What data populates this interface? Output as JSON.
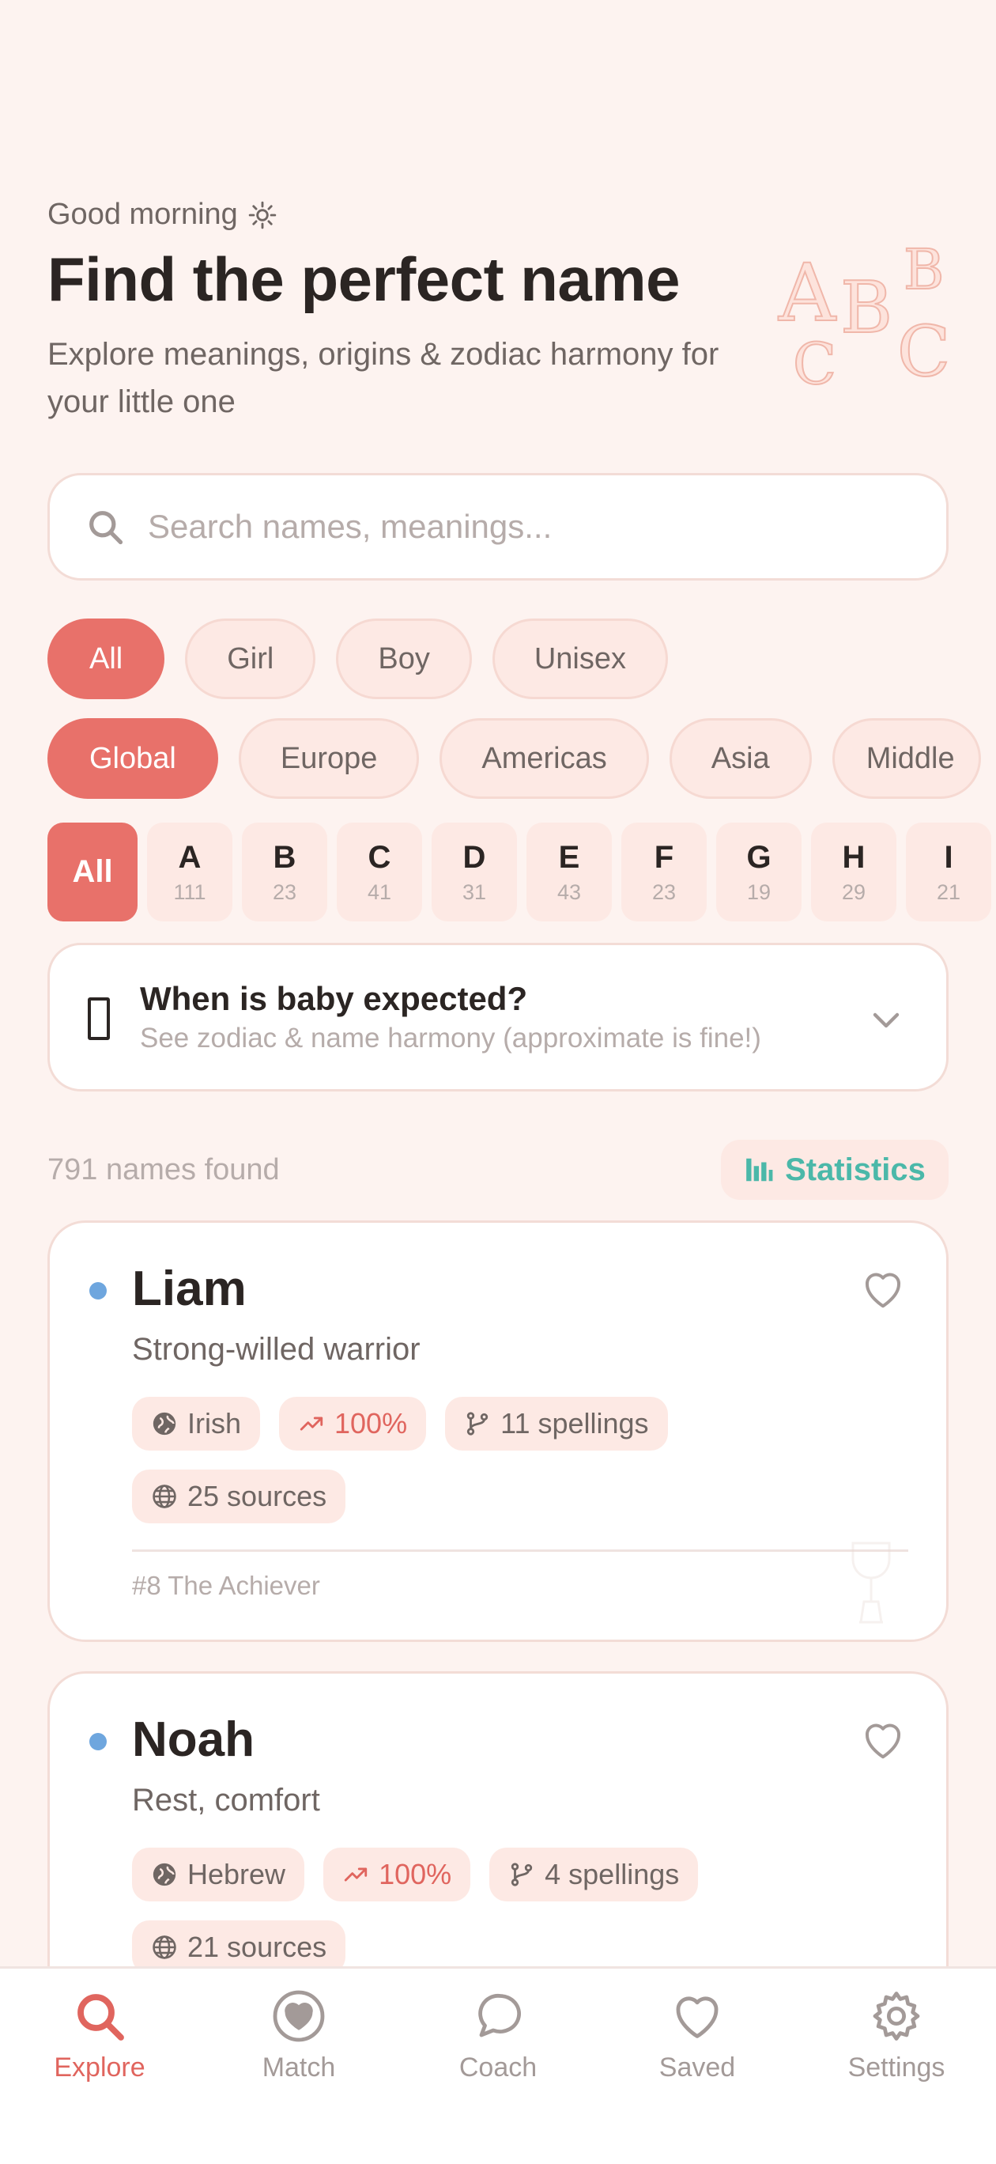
{
  "header": {
    "greeting": "Good morning",
    "title": "Find the perfect name",
    "subtitle": "Explore meanings, origins & zodiac harmony for your little one"
  },
  "search": {
    "placeholder": "Search names, meanings..."
  },
  "gender_filters": [
    "All",
    "Girl",
    "Boy",
    "Unisex"
  ],
  "region_filters": [
    "Global",
    "Europe",
    "Americas",
    "Asia",
    "Middle"
  ],
  "letters": [
    {
      "letter": "All",
      "count": ""
    },
    {
      "letter": "A",
      "count": "111"
    },
    {
      "letter": "B",
      "count": "23"
    },
    {
      "letter": "C",
      "count": "41"
    },
    {
      "letter": "D",
      "count": "31"
    },
    {
      "letter": "E",
      "count": "43"
    },
    {
      "letter": "F",
      "count": "23"
    },
    {
      "letter": "G",
      "count": "19"
    },
    {
      "letter": "H",
      "count": "29"
    },
    {
      "letter": "I",
      "count": "21"
    }
  ],
  "due": {
    "question": "When is baby expected?",
    "hint": "See zodiac & name harmony (approximate is fine!)"
  },
  "results": {
    "found": "791 names found",
    "stats_label": "Statistics"
  },
  "cards": [
    {
      "name": "Liam",
      "meaning": "Strong-willed warrior",
      "origin": "Irish",
      "popularity": "100%",
      "spellings": "11 spellings",
      "sources": "25 sources",
      "numerology": "#8 The Achiever"
    },
    {
      "name": "Noah",
      "meaning": "Rest, comfort",
      "origin": "Hebrew",
      "popularity": "100%",
      "spellings": "4 spellings",
      "sources": "21 sources"
    }
  ],
  "nav": {
    "explore": "Explore",
    "match": "Match",
    "coach": "Coach",
    "saved": "Saved",
    "settings": "Settings"
  },
  "colors": {
    "background": "#fdf3f0",
    "accent": "#e8716a",
    "teal": "#4bb8a9",
    "boy_dot": "#6ea6de"
  }
}
